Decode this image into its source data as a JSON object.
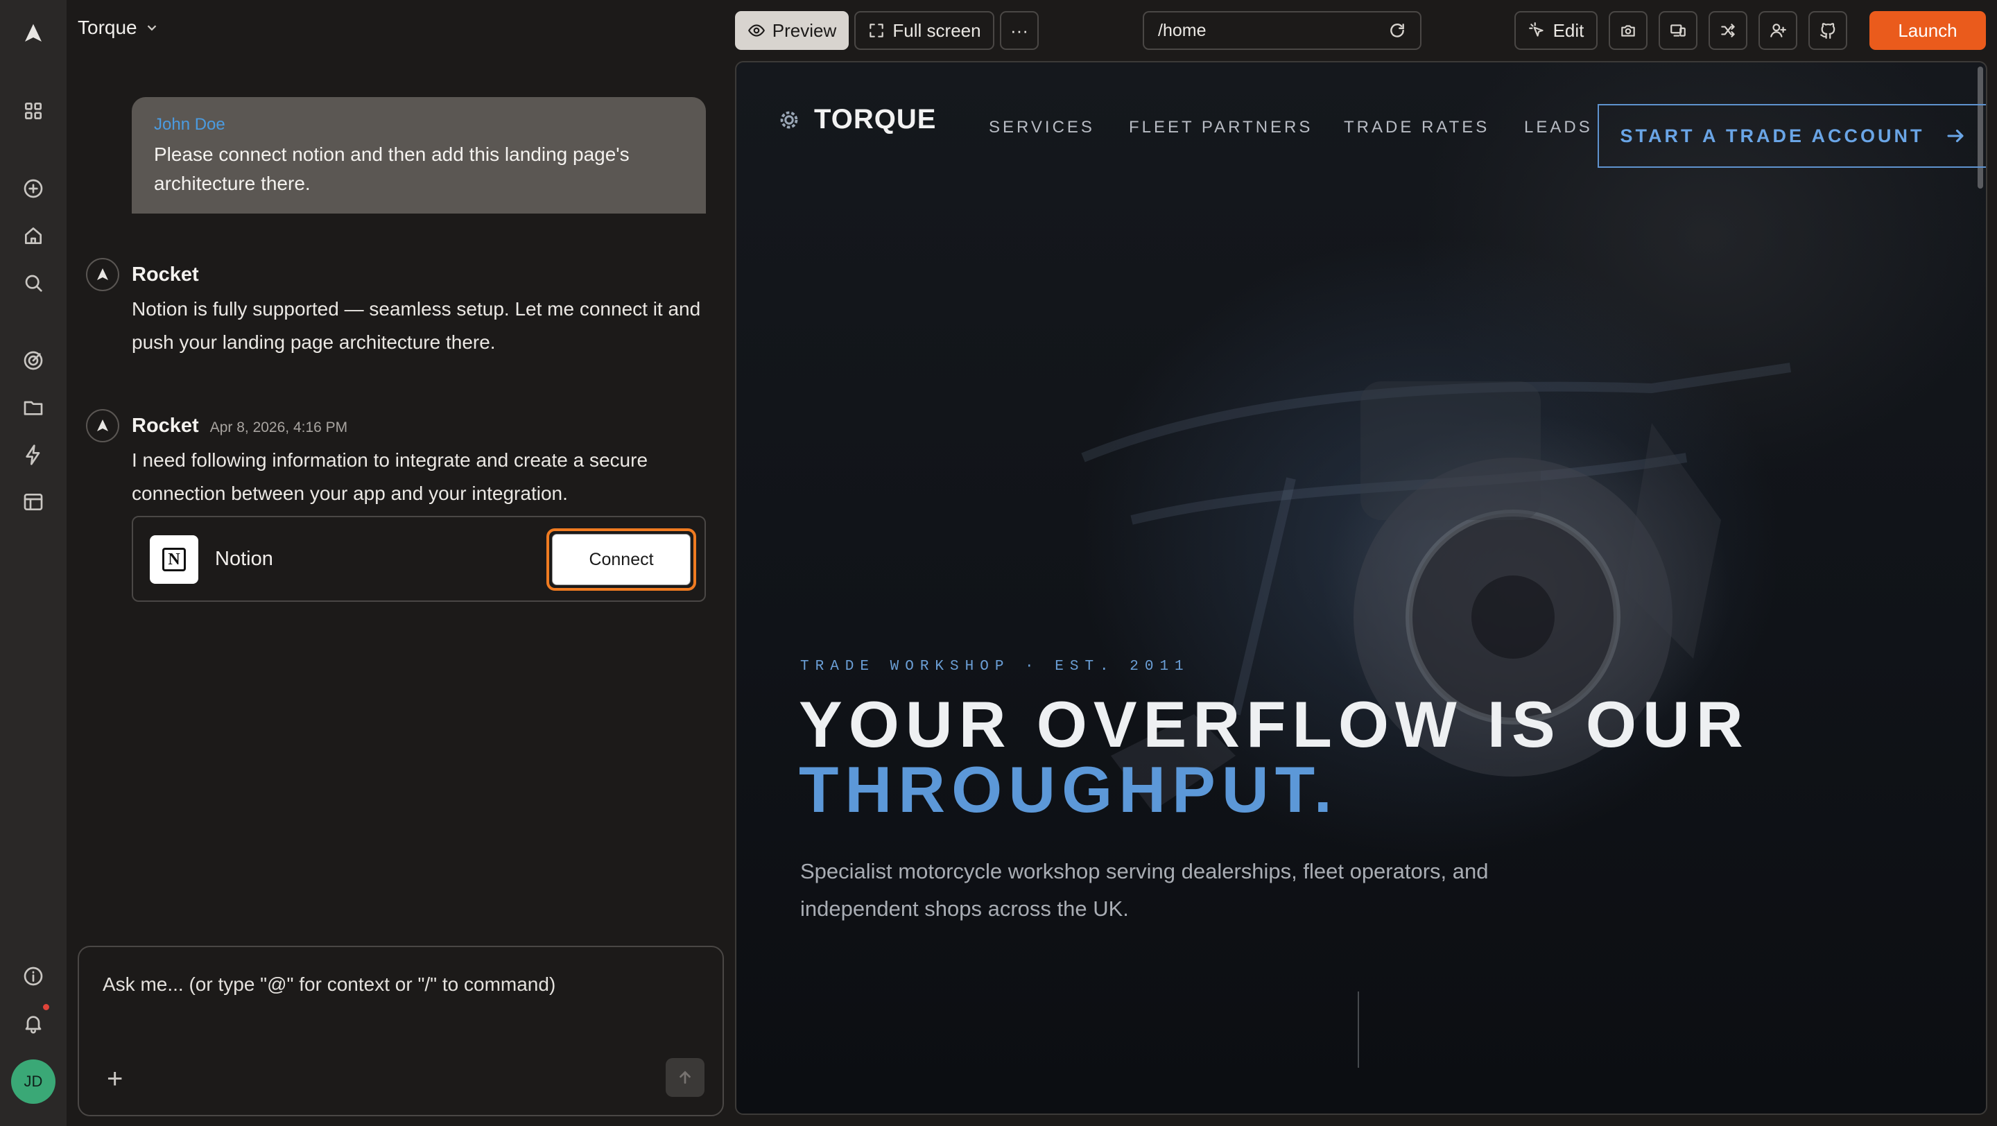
{
  "project": {
    "name": "Torque"
  },
  "messages": {
    "user": {
      "name": "John Doe",
      "text": "Please connect notion and then add this landing page's architecture there."
    },
    "bot1": {
      "name": "Rocket",
      "text": "Notion is fully supported — seamless setup. Let me connect it and push your landing page architecture there."
    },
    "bot2": {
      "name": "Rocket",
      "time": "Apr 8, 2026, 4:16 PM",
      "text": "I need following information to integrate and create a secure connection between your app and your integration."
    }
  },
  "integration": {
    "name": "Notion",
    "logo_letter": "N",
    "button_label": "Connect"
  },
  "composer": {
    "placeholder": "Ask me... (or type \"@\" for context or \"/\" to command)"
  },
  "user_avatar": {
    "initials": "JD"
  },
  "toolbar": {
    "preview_label": "Preview",
    "fullscreen_label": "Full screen",
    "more_label": "···",
    "url": "/home",
    "edit_label": "Edit",
    "launch_label": "Launch"
  },
  "site": {
    "brand": "TORQUE",
    "nav": [
      "SERVICES",
      "FLEET PARTNERS",
      "TRADE RATES",
      "LEADS"
    ],
    "cta": "START A TRADE ACCOUNT",
    "eyebrow": "TRADE WORKSHOP · EST. 2011",
    "headline_1": "YOUR OVERFLOW IS OUR",
    "headline_2": "THROUGHPUT.",
    "subtext": "Specialist motorcycle workshop serving dealerships, fleet operators, and independent shops across the UK."
  },
  "colors": {
    "accent_orange": "#ea5b1c",
    "link_blue": "#4b9be0",
    "site_blue": "#5c98d8"
  }
}
